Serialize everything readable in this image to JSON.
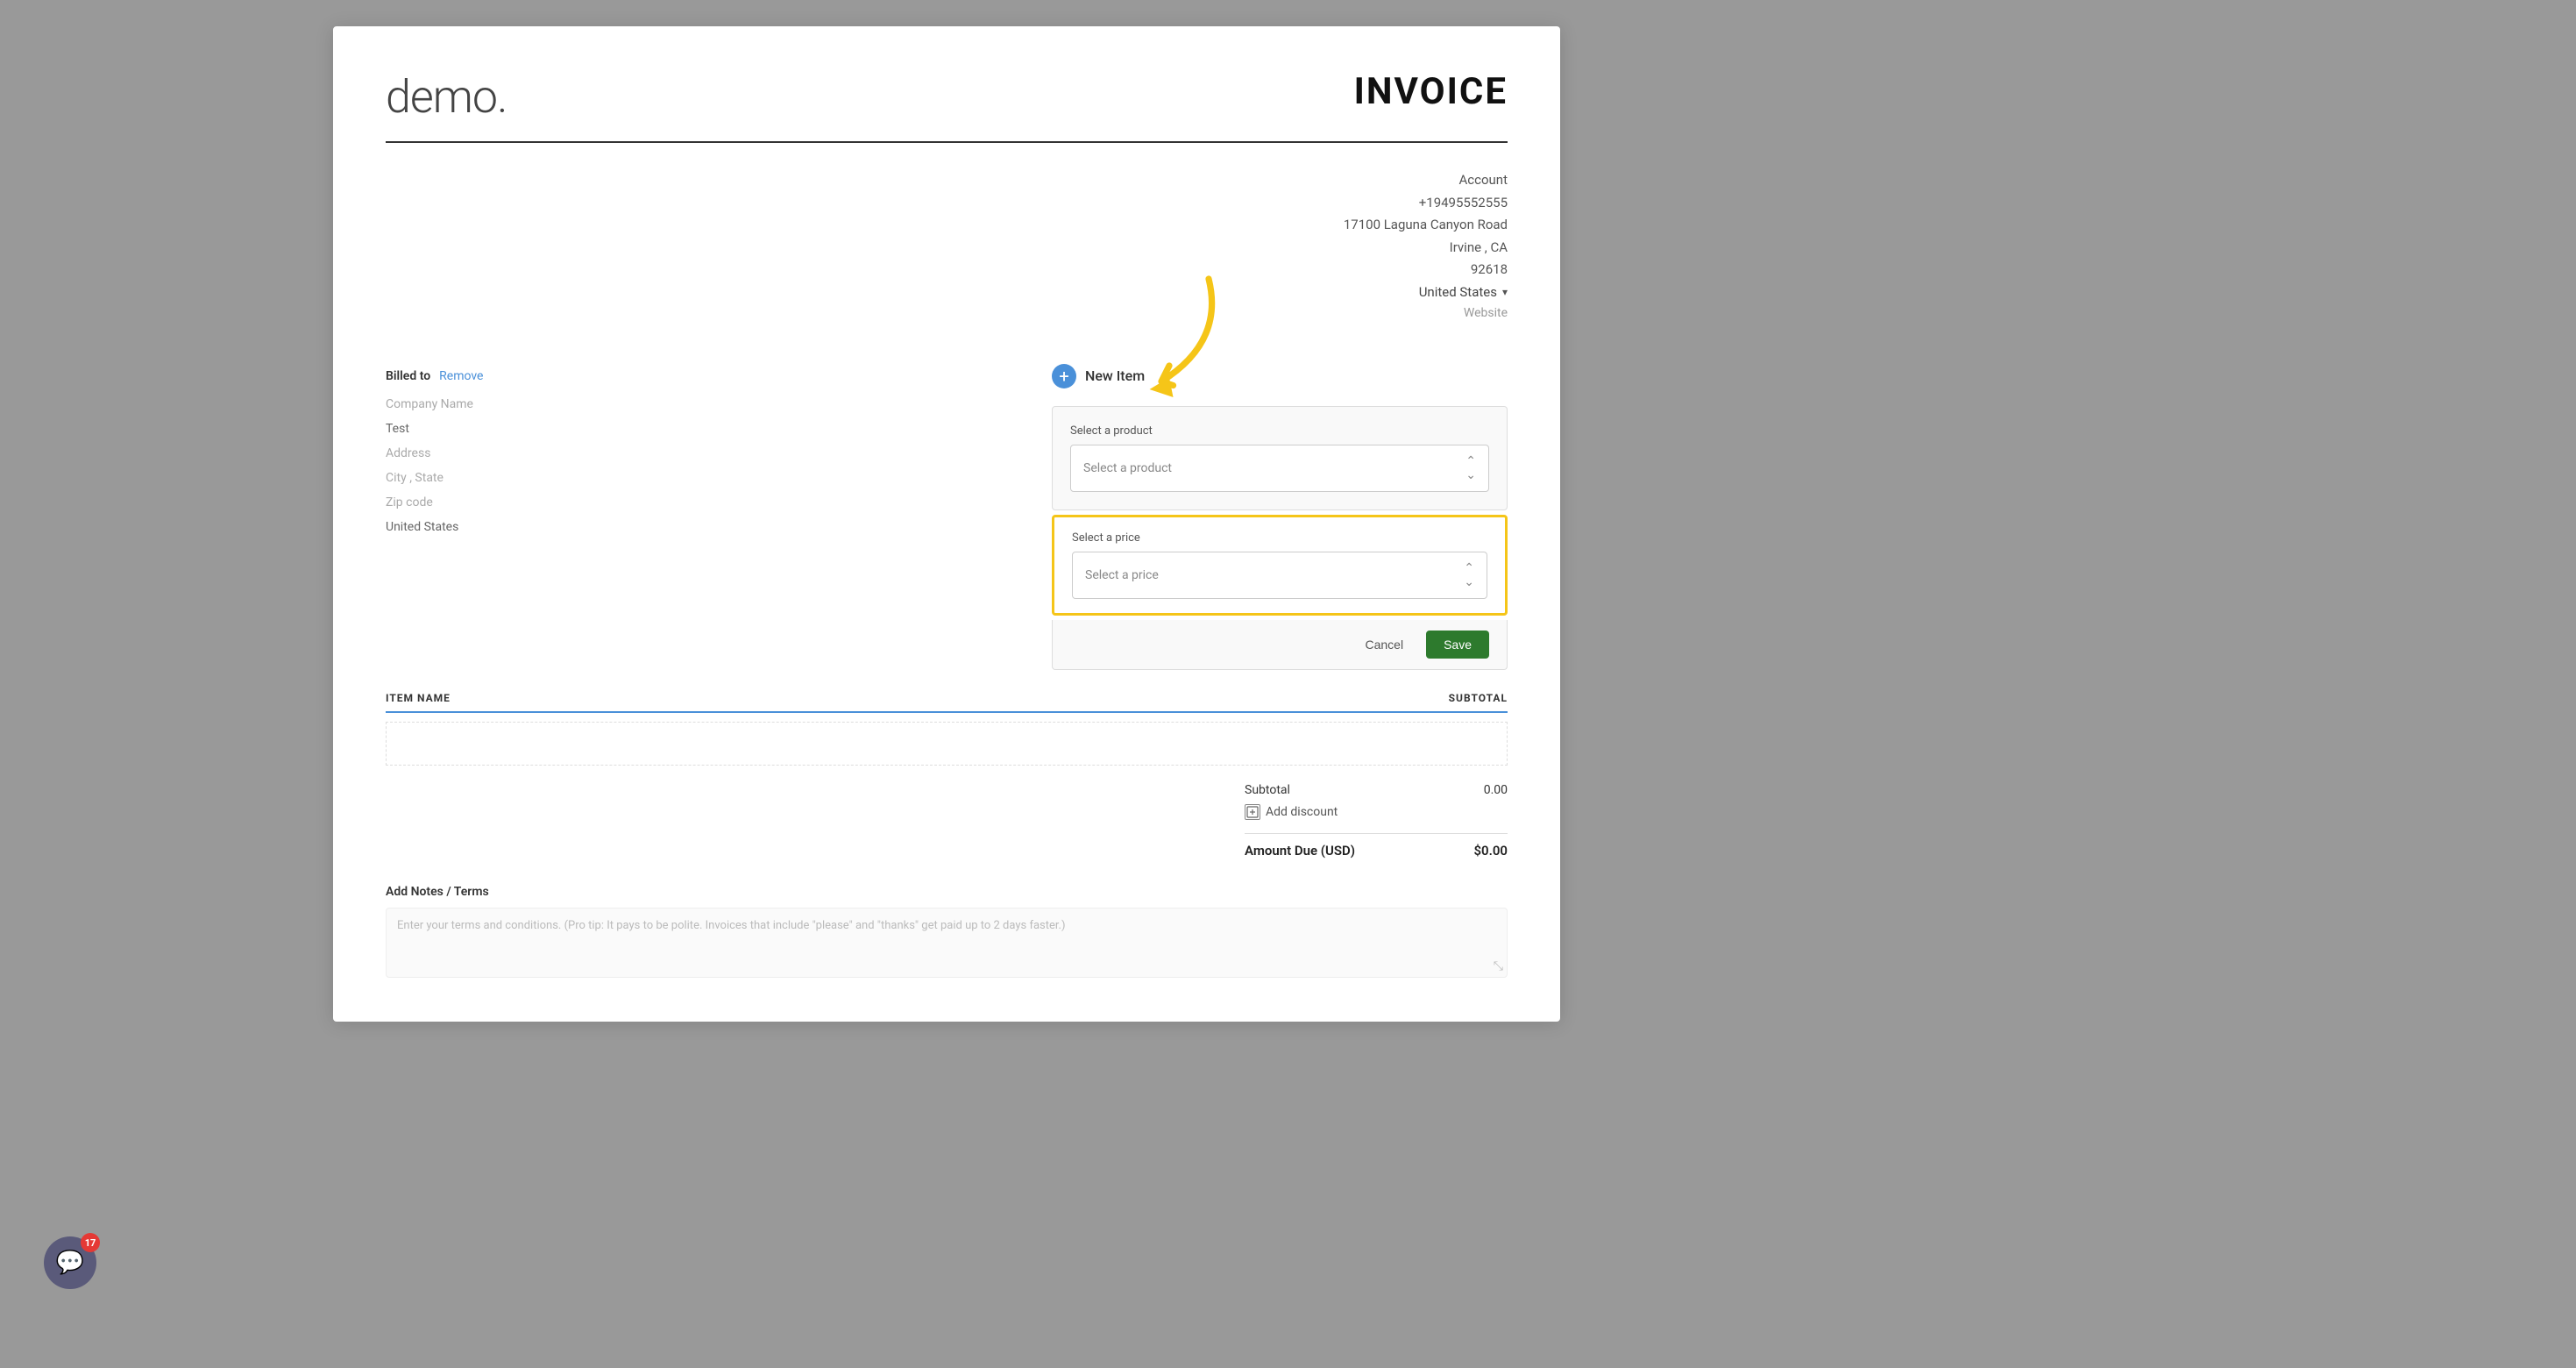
{
  "page": {
    "background_color": "#999"
  },
  "invoice": {
    "title": "INVOICE",
    "logo": "demo.",
    "company": {
      "label": "Account",
      "phone": "+19495552555",
      "address": "17100 Laguna Canyon Road",
      "city_state": "Irvine ,  CA",
      "zip": "92618",
      "country": "United States",
      "website_label": "Website"
    },
    "billed_to": {
      "label": "Billed to",
      "remove_label": "Remove",
      "company_name_placeholder": "Company Name",
      "name": "Test",
      "address_placeholder": "Address",
      "city_state_placeholder": "City , State",
      "zip_placeholder": "Zip code",
      "country": "United States"
    },
    "new_item": {
      "label": "New Item",
      "product_select_label": "Select a product",
      "product_select_placeholder": "Select a product",
      "price_select_label": "Select a price",
      "price_select_placeholder": "Select a price",
      "cancel_label": "Cancel",
      "save_label": "Save"
    },
    "table": {
      "item_name_header": "ITEM NAME",
      "subtotal_header": "SUBTOTAL"
    },
    "totals": {
      "subtotal_label": "Subtotal",
      "subtotal_value": "0.00",
      "add_discount_label": "Add discount",
      "amount_due_label": "Amount Due (USD)",
      "amount_due_value": "$0.00"
    },
    "notes": {
      "label": "Add Notes / Terms",
      "placeholder": "Enter your terms and conditions. (Pro tip: It pays to be polite. Invoices that include \"please\" and \"thanks\" get paid up to 2 days faster.)"
    }
  },
  "chat_widget": {
    "badge_count": "17"
  }
}
